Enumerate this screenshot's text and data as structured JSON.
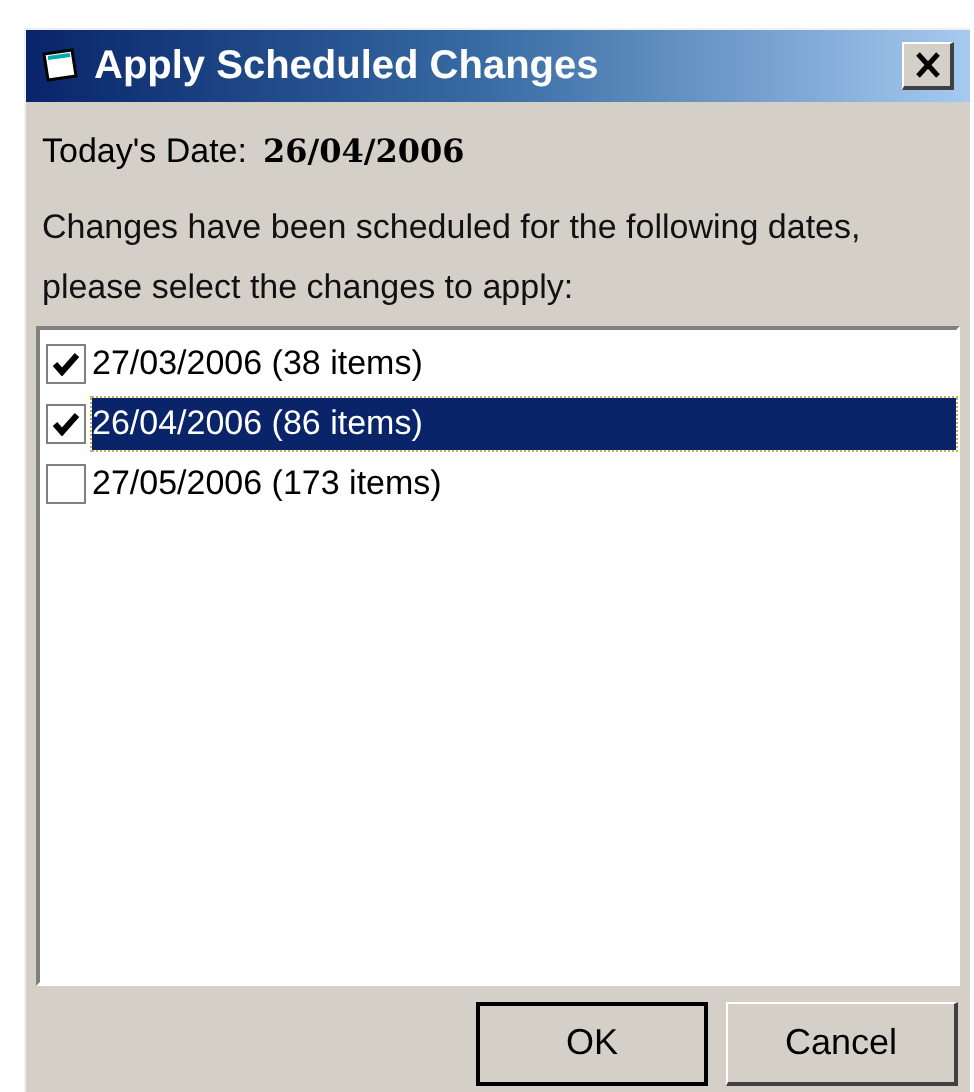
{
  "window": {
    "title": "Apply Scheduled Changes"
  },
  "today": {
    "label": "Today's Date:",
    "value": "26/04/2006"
  },
  "instructions": "Changes have been scheduled for the following dates, please select the changes to apply:",
  "items": [
    {
      "label": "27/03/2006 (38 items)",
      "checked": true,
      "selected": false
    },
    {
      "label": "26/04/2006 (86 items)",
      "checked": true,
      "selected": true
    },
    {
      "label": "27/05/2006 (173 items)",
      "checked": false,
      "selected": false
    }
  ],
  "buttons": [
    {
      "label": "OK",
      "default": true
    },
    {
      "label": "Cancel",
      "default": false
    }
  ]
}
